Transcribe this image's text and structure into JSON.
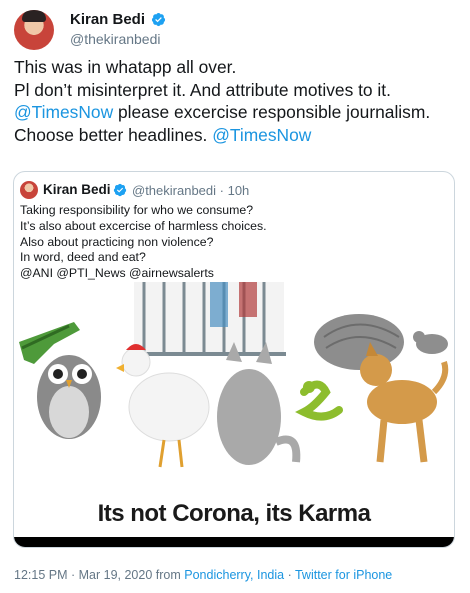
{
  "tweet": {
    "author_name": "Kiran Bedi",
    "author_handle": "@thekiranbedi",
    "lines": [
      {
        "text": "This was in whatapp all over."
      },
      {
        "text": "Pl don’t misinterpret it. And attribute motives to it."
      },
      {
        "prefix": "",
        "mention": "@TimesNow",
        "suffix": " please excercise responsible journalism."
      },
      {
        "prefix": "Choose better headlines. ",
        "mention": "@TimesNow",
        "suffix": ""
      }
    ]
  },
  "quoted_tweet": {
    "author_name": "Kiran Bedi",
    "author_handle": "@thekiranbedi",
    "age": "10h",
    "separator": " · ",
    "lines": [
      "Taking responsibility for who we consume?",
      "It’s also about excercise of harmless choices.",
      "Also about practicing non violence?",
      "In word, deed and eat?",
      "@ANI @PTI_News @airnewsalerts"
    ],
    "image_caption": "Its not Corona, its Karma"
  },
  "meta": {
    "time": "12:15 PM",
    "date": "Mar 19, 2020",
    "from_label": "from",
    "location": "Pondicherry, India",
    "source": "Twitter for iPhone",
    "dot": " · "
  },
  "icons": [
    "verified-badge-icon"
  ],
  "colors": {
    "link": "#1b95e0",
    "secondary": "#657786",
    "border": "#ccd6dd",
    "verified": "#1da1f2"
  }
}
